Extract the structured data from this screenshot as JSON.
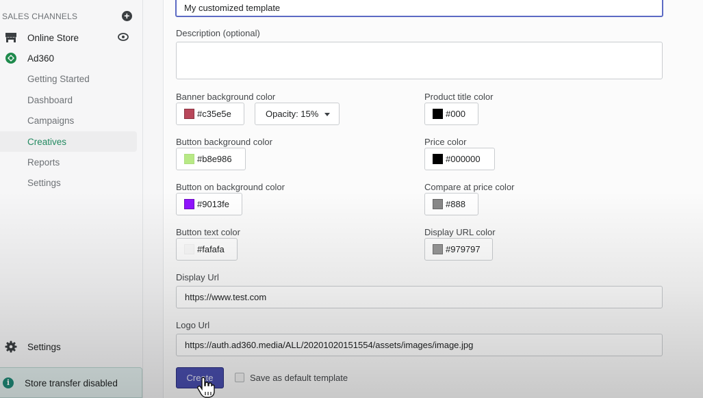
{
  "sidebar": {
    "section_title": "SALES CHANNELS",
    "add_icon": "plus-circle-icon",
    "channels": [
      {
        "label": "Online Store",
        "icon": "storefront-icon",
        "action_icon": "eye-icon"
      },
      {
        "label": "Ad360",
        "icon": "ad360-logo-icon"
      }
    ],
    "sub_items": [
      {
        "label": "Getting Started",
        "active": false
      },
      {
        "label": "Dashboard",
        "active": false
      },
      {
        "label": "Campaigns",
        "active": false
      },
      {
        "label": "Creatives",
        "active": true
      },
      {
        "label": "Reports",
        "active": false
      },
      {
        "label": "Settings",
        "active": false
      }
    ],
    "settings": {
      "label": "Settings",
      "icon": "gear-icon"
    },
    "transfer_notice": {
      "label": "Store transfer disabled",
      "icon": "info-icon"
    }
  },
  "form": {
    "name_value": "My customized template",
    "description": {
      "label": "Description (optional)",
      "value": ""
    },
    "banner_bg": {
      "label": "Banner background color",
      "value": "#c35e5e",
      "swatch": "#b8475a"
    },
    "opacity": {
      "label": "Opacity: 15%",
      "selected": "15%"
    },
    "button_bg": {
      "label": "Button background color",
      "value": "#b8e986",
      "swatch": "#b8e986"
    },
    "button_on_bg": {
      "label": "Button on background color",
      "value": "#9013fe",
      "swatch": "#9013fe"
    },
    "button_text": {
      "label": "Button text color",
      "value": "#fafafa",
      "swatch": "#fafafa"
    },
    "product_title": {
      "label": "Product title color",
      "value": "#000",
      "swatch": "#000000"
    },
    "price": {
      "label": "Price color",
      "value": "#000000",
      "swatch": "#000000"
    },
    "compare_price": {
      "label": "Compare at price color",
      "value": "#888",
      "swatch": "#888888"
    },
    "display_url_color": {
      "label": "Display URL color",
      "value": "#979797",
      "swatch": "#979797"
    },
    "display_url": {
      "label": "Display Url",
      "value": "https://www.test.com"
    },
    "logo_url": {
      "label": "Logo Url",
      "value": "https://auth.ad360.media/ALL/20201020151554/assets/images/image.jpg"
    },
    "create_label": "Create",
    "default_checkbox": {
      "label": "Save as default template",
      "checked": false
    }
  },
  "colors": {
    "accent": "#4a4fb0",
    "active_nav": "#238a61",
    "focus_border": "#5c6ac4"
  }
}
